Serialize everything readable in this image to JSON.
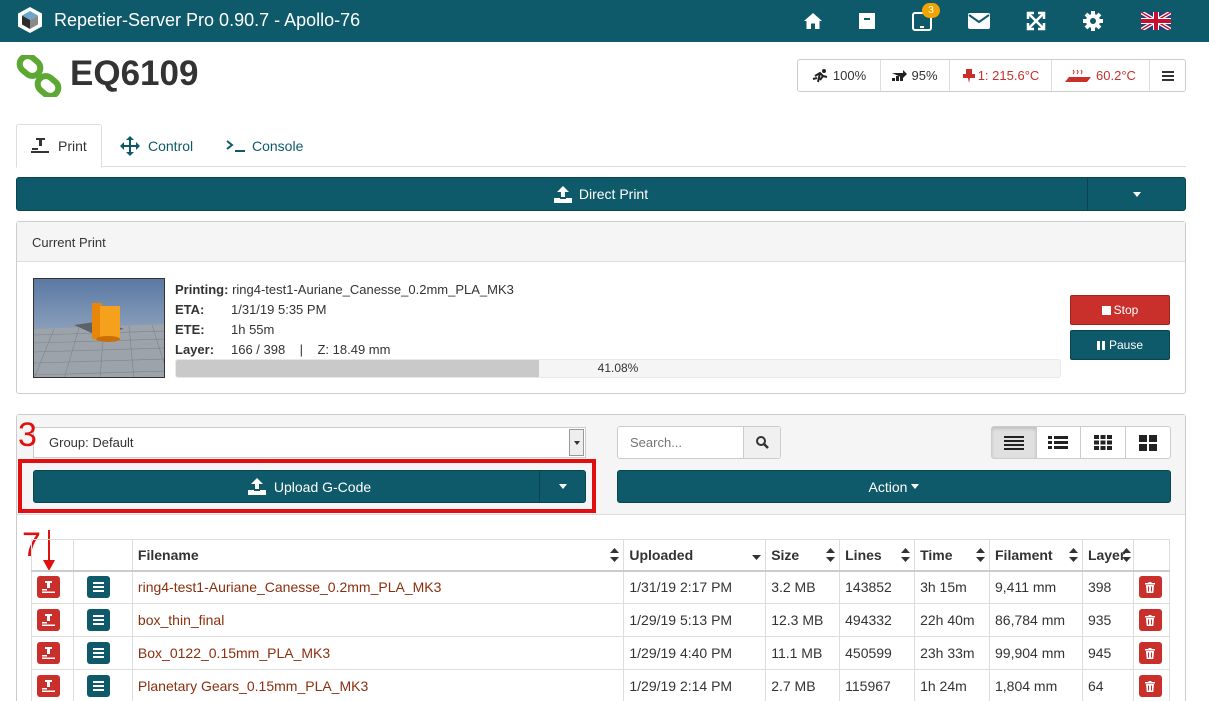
{
  "app": {
    "title": "Repetier-Server Pro 0.90.7 - Apollo-76",
    "notification_count": "3"
  },
  "printer": {
    "name": "EQ6109",
    "status": {
      "speed": "100%",
      "flow": "95%",
      "extruder": "1: 215.6°C",
      "bed": "60.2°C"
    }
  },
  "tabs": [
    {
      "label": "Print",
      "icon": "print-head-icon"
    },
    {
      "label": "Control",
      "icon": "move-arrows-icon"
    },
    {
      "label": "Console",
      "icon": "terminal-icon"
    }
  ],
  "direct_print": {
    "label": "Direct Print"
  },
  "current_print": {
    "heading": "Current Print",
    "printing_label": "Printing:",
    "printing_value": "ring4-test1-Auriane_Canesse_0.2mm_PLA_MK3",
    "eta_label": "ETA:",
    "eta_value": "1/31/19 5:35 PM",
    "ete_label": "ETE:",
    "ete_value": "1h 55m",
    "layer_label": "Layer:",
    "layer_value": "166 / 398    |    Z: 18.49 mm",
    "progress": 41.08,
    "progress_text": "41.08%",
    "stop_label": "Stop",
    "pause_label": "Pause"
  },
  "files": {
    "group_select": "Group: Default",
    "search_placeholder": "Search...",
    "upload_label": "Upload G-Code",
    "action_label": "Action",
    "columns": [
      "Filename",
      "Uploaded",
      "Size",
      "Lines",
      "Time",
      "Filament",
      "Layer"
    ],
    "rows": [
      {
        "filename": "ring4-test1-Auriane_Canesse_0.2mm_PLA_MK3",
        "uploaded": "1/31/19 2:17 PM",
        "size": "3.2 MB",
        "lines": "143852",
        "time": "3h 15m",
        "filament": "9,411 mm",
        "layer": "398"
      },
      {
        "filename": "box_thin_final",
        "uploaded": "1/29/19 5:13 PM",
        "size": "12.3 MB",
        "lines": "494332",
        "time": "22h 40m",
        "filament": "86,784 mm",
        "layer": "935"
      },
      {
        "filename": "Box_0122_0.15mm_PLA_MK3",
        "uploaded": "1/29/19 4:40 PM",
        "size": "11.1 MB",
        "lines": "450599",
        "time": "23h 33m",
        "filament": "99,904 mm",
        "layer": "945"
      },
      {
        "filename": "Planetary Gears_0.15mm_PLA_MK3",
        "uploaded": "1/29/19 2:14 PM",
        "size": "2.7 MB",
        "lines": "115967",
        "time": "1h 24m",
        "filament": "1,804 mm",
        "layer": "64"
      }
    ]
  },
  "annotations": {
    "upload_step": "3",
    "print_step": "7"
  },
  "colors": {
    "primary": "#0e5a6a",
    "danger": "#c9302c",
    "annotation": "#e01010",
    "filename": "#8b2f0e"
  }
}
